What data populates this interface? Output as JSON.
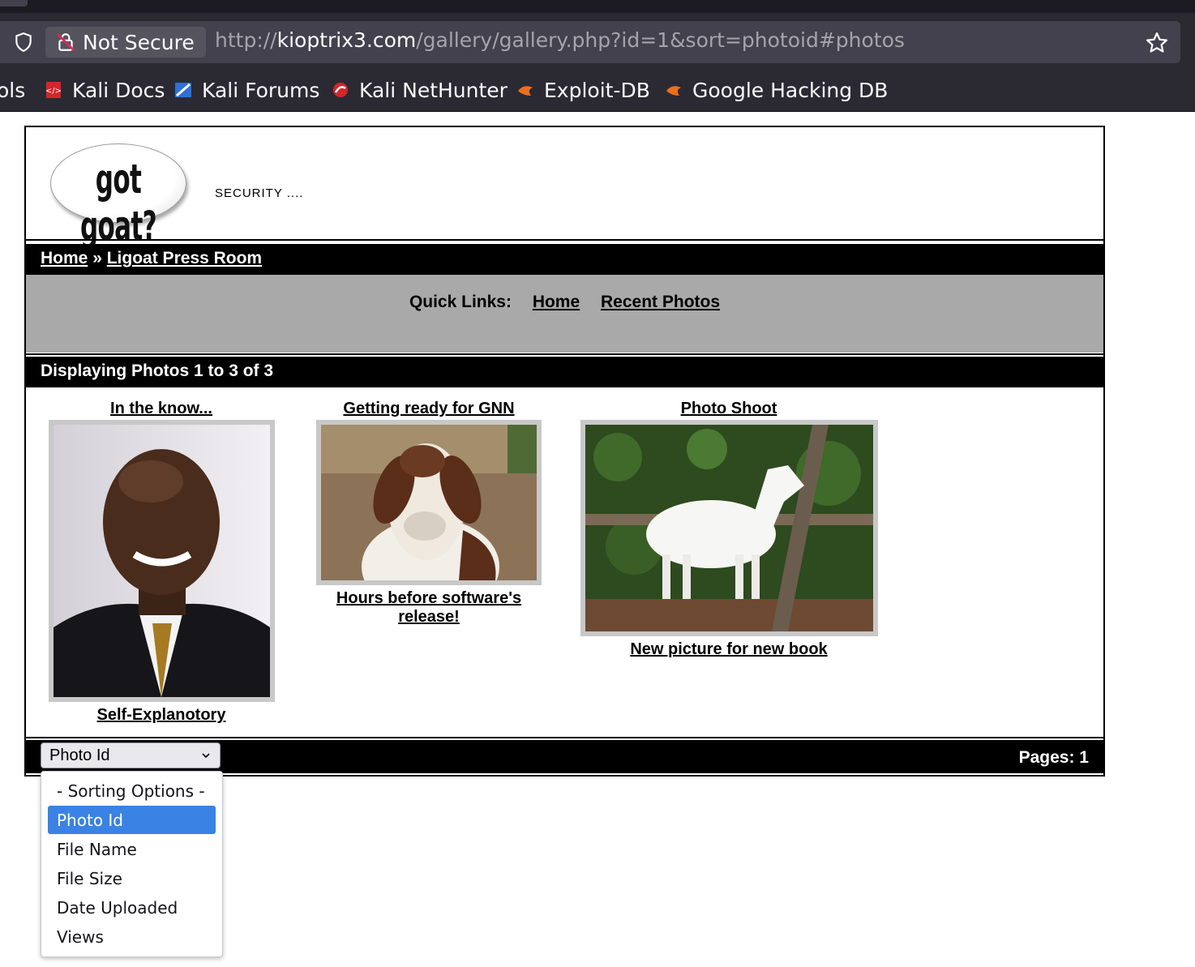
{
  "browser": {
    "security_label": "Not Secure",
    "url_prefix": "http://",
    "url_host": "kioptrix3.com",
    "url_path": "/gallery/gallery.php?id=1&sort=photoid#photos"
  },
  "bookmarks": [
    {
      "label": "ols",
      "icon": "tools-icon"
    },
    {
      "label": "Kali Docs",
      "icon": "kali-docs-icon"
    },
    {
      "label": "Kali Forums",
      "icon": "kali-forums-icon"
    },
    {
      "label": "Kali NetHunter",
      "icon": "kali-nethunter-icon"
    },
    {
      "label": "Exploit-DB",
      "icon": "exploit-db-icon"
    },
    {
      "label": "Google Hacking DB",
      "icon": "ghdb-icon"
    }
  ],
  "site": {
    "logo_text": "got goat?",
    "tagline": "SECURITY ....",
    "breadcrumb": {
      "home": "Home",
      "separator": "»",
      "current": "Ligoat Press Room"
    },
    "quick_links": {
      "label": "Quick Links:",
      "links": [
        "Home",
        "Recent Photos"
      ]
    },
    "display_status": "Displaying Photos 1 to 3 of 3",
    "photos": [
      {
        "title": "In the know...",
        "caption": "Self-Explanotory",
        "icon": "portrait-photo"
      },
      {
        "title": "Getting ready for GNN",
        "caption": "Hours before software's release!",
        "icon": "goat-closeup-photo"
      },
      {
        "title": "Photo Shoot",
        "caption": "New picture for new book",
        "icon": "white-goat-photo"
      }
    ],
    "sort_select": {
      "value": "Photo Id"
    },
    "pages": "Pages: 1"
  },
  "sort_dropdown": {
    "options": [
      "- Sorting Options -",
      "Photo Id",
      "File Name",
      "File Size",
      "Date Uploaded",
      "Views"
    ],
    "selected": "Photo Id"
  },
  "colors": {
    "highlight": "#3a82e4",
    "bar": "#000000",
    "quickbar": "#a9a9a9",
    "chrome": "#2b2a33"
  }
}
